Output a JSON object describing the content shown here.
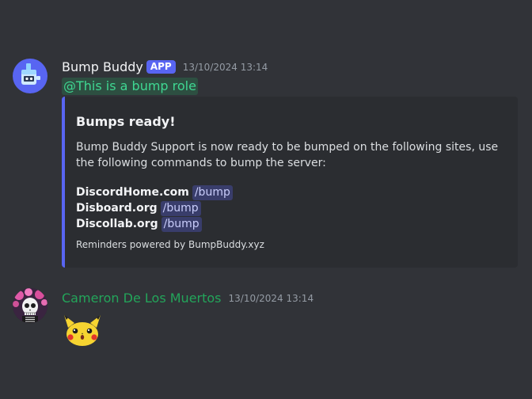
{
  "messages": [
    {
      "author": "Bump Buddy",
      "badge": "APP",
      "timestamp": "13/10/2024 13:14",
      "mention": "@This is a bump role",
      "embed": {
        "title": "Bumps ready!",
        "description": "Bump Buddy Support is now ready to be bumped on the following sites, use the following commands to bump the server:",
        "bumps": [
          {
            "site": "DiscordHome.com",
            "command": "/bump"
          },
          {
            "site": "Disboard.org",
            "command": "/bump"
          },
          {
            "site": "Discollab.org",
            "command": "/bump"
          }
        ],
        "footer": "Reminders powered by BumpBuddy.xyz",
        "accent_color": "#5865f2"
      }
    },
    {
      "author": "Cameron De Los Muertos",
      "timestamp": "13/10/2024 13:14",
      "sticker": "surprised-pikachu-sticker",
      "author_color": "#23a55a"
    }
  ]
}
